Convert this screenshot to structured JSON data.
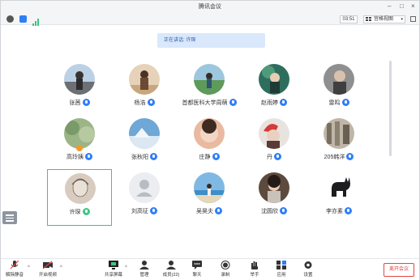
{
  "window": {
    "title": "腾讯会议"
  },
  "statusbar": {
    "timer": "03:51",
    "view_label": "宫格视图"
  },
  "banner": {
    "speaking": "正在讲话: 许琛"
  },
  "participants": [
    {
      "name": "张茜"
    },
    {
      "name": "杨浩"
    },
    {
      "name": "首都医科大学周萌"
    },
    {
      "name": "赵雨婷"
    },
    {
      "name": "雷鸣"
    },
    {
      "name": "高玲姨"
    },
    {
      "name": "张秋阳"
    },
    {
      "name": "庄静"
    },
    {
      "name": "丹"
    },
    {
      "name": "205韩洋"
    },
    {
      "name": "许琛"
    },
    {
      "name": "刘高征"
    },
    {
      "name": "吴昊夫"
    },
    {
      "name": "沈圆欣"
    },
    {
      "name": "李亦素"
    }
  ],
  "toolbar": {
    "unmute": "解除静音",
    "start_video": "开启视频",
    "share_screen": "共享屏幕",
    "manage": "管理",
    "members": "成员(22)",
    "chat": "聊天",
    "record": "录制",
    "hands": "举手",
    "apps": "应用",
    "settings": "设置",
    "leave": "离开会议"
  },
  "colors": {
    "accent": "#2f7ef5",
    "active_border": "#3fc582",
    "leave": "#e64545",
    "banner_bg": "#d9e8fb"
  }
}
